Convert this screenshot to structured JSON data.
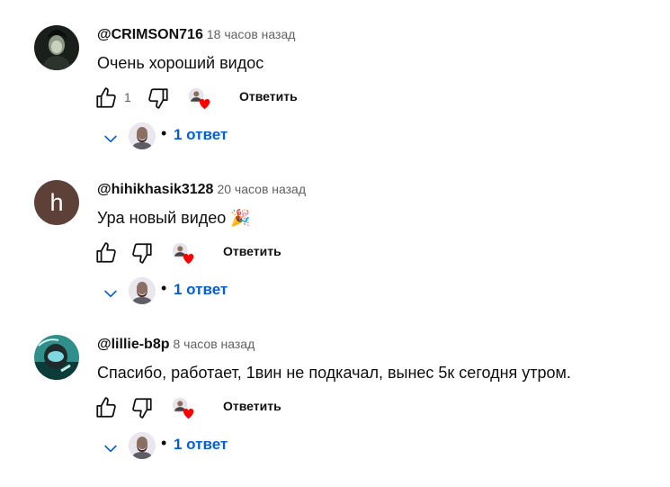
{
  "comments": [
    {
      "author": "@CRIMSON716",
      "time": "18 часов назад",
      "text": "Очень хороший видос",
      "like_count": "1",
      "reply_label": "Ответить",
      "replies_label": "1 ответ",
      "avatar": "dark-portrait-avatar"
    },
    {
      "author": "@hihikhasik3128",
      "time": "20 часов назад",
      "text": "Ура новый видео 🎉",
      "like_count": "",
      "reply_label": "Ответить",
      "replies_label": "1 ответ",
      "avatar_letter": "h",
      "avatar_color": "#5d4037"
    },
    {
      "author": "@lillie-b8p",
      "time": "8 часов назад",
      "text": "Спасибо, работает, 1вин не подкачал, вынес 5к сегодня утром.",
      "like_count": "",
      "reply_label": "Ответить",
      "replies_label": "1 ответ",
      "avatar": "teal-helmet-avatar"
    }
  ],
  "separator": "•",
  "colors": {
    "link_blue": "#065fd4",
    "heart_red": "#ff0000",
    "secondary_text": "#606060"
  },
  "icons": [
    "like-icon",
    "dislike-icon",
    "creator-heart-icon",
    "chevron-down-icon"
  ]
}
